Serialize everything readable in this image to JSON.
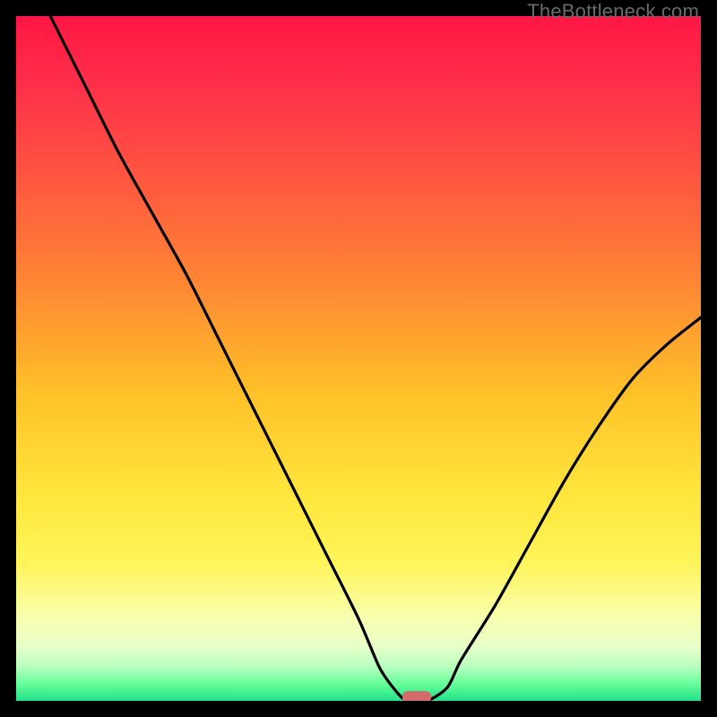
{
  "watermark": "TheBottleneck.com",
  "chart_data": {
    "type": "line",
    "title": "",
    "xlabel": "",
    "ylabel": "",
    "xlim": [
      0,
      100
    ],
    "ylim": [
      0,
      100
    ],
    "grid": false,
    "legend": false,
    "series": [
      {
        "name": "bottleneck-curve",
        "x": [
          5,
          10,
          15,
          20,
          25,
          30,
          35,
          40,
          45,
          50,
          53,
          55,
          57,
          60,
          63,
          65,
          70,
          75,
          80,
          85,
          90,
          95,
          100
        ],
        "y": [
          100,
          90,
          80,
          71,
          62,
          52,
          42,
          32,
          22,
          12,
          5,
          2,
          0,
          0,
          2,
          6,
          14,
          23,
          32,
          40,
          47,
          52,
          56
        ]
      }
    ],
    "marker": {
      "x": 58.5,
      "y": 0.5,
      "color": "#d46a6a",
      "shape": "pill"
    },
    "background_gradient": {
      "stops": [
        {
          "offset": 0.0,
          "color": "#ff1744"
        },
        {
          "offset": 0.1,
          "color": "#ff2f4a"
        },
        {
          "offset": 0.25,
          "color": "#ff5a3f"
        },
        {
          "offset": 0.4,
          "color": "#ff8a33"
        },
        {
          "offset": 0.55,
          "color": "#ffc128"
        },
        {
          "offset": 0.7,
          "color": "#ffe63c"
        },
        {
          "offset": 0.8,
          "color": "#fff55a"
        },
        {
          "offset": 0.88,
          "color": "#f8ffb0"
        },
        {
          "offset": 0.92,
          "color": "#e8ffc8"
        },
        {
          "offset": 0.95,
          "color": "#b8ffc0"
        },
        {
          "offset": 0.975,
          "color": "#66ff99"
        },
        {
          "offset": 1.0,
          "color": "#22e08a"
        }
      ]
    }
  }
}
